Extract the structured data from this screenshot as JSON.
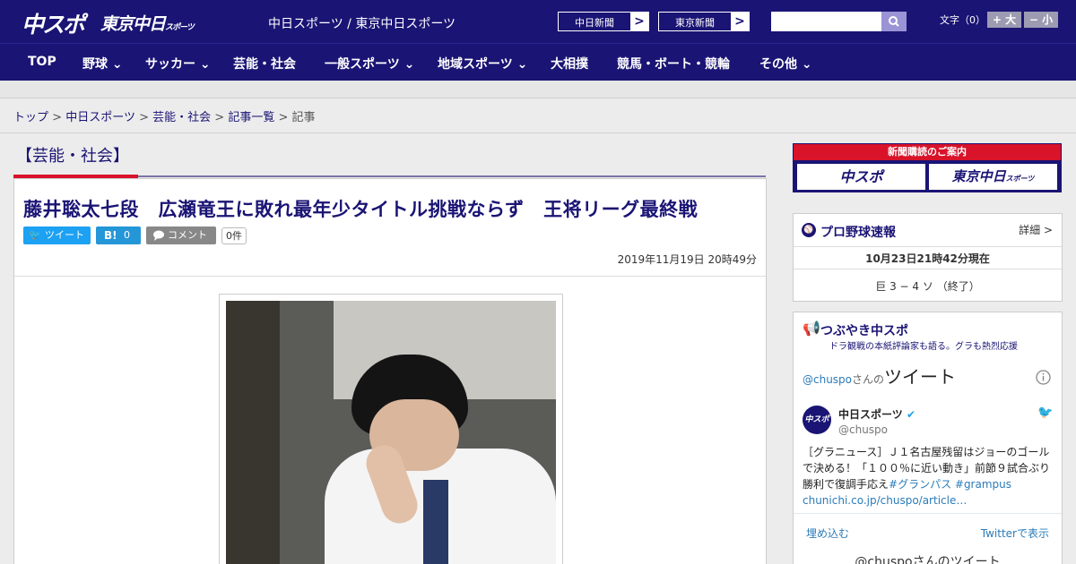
{
  "header": {
    "logo_main": "中スポ",
    "logo_tokyo": "東京中日",
    "logo_tokyo_small": "スポーツ",
    "site_name": "中日スポーツ / 東京中日スポーツ",
    "paper_button_1": "中日新聞",
    "paper_button_2": "東京新聞",
    "arrow": ">",
    "search_placeholder": "",
    "font_size_label": "文字（0）",
    "font_plus": "+ 大",
    "font_minus": "− 小"
  },
  "nav": {
    "items": [
      "TOP",
      "野球",
      "サッカー",
      "芸能・社会",
      "一般スポーツ",
      "地域スポーツ",
      "大相撲",
      "競馬・ボート・競輪",
      "その他"
    ],
    "chevron": "⌄"
  },
  "breadcrumb": {
    "items": [
      "トップ",
      "中日スポーツ",
      "芸能・社会",
      "記事一覧"
    ],
    "current": "記事",
    "sep": ">"
  },
  "article": {
    "section": "【芸能・社会】",
    "headline": "藤井聡太七段　広瀬竜王に敗れ最年少タイトル挑戦ならず　王将リーグ最終戦",
    "tweet_label": "ツイート",
    "hatena_label": "B!",
    "hatena_count": "0",
    "comment_label": "コメント",
    "comment_count": "0件",
    "date": "2019年11月19日 20時49分"
  },
  "sidebar": {
    "ad_top": "新聞購読のご案内",
    "ad_left": "中スポ",
    "ad_right": "東京中日",
    "ad_right_small": "スポーツ",
    "baseball": {
      "title": "プロ野球速報",
      "detail": "詳細 >",
      "as_of": "10月23日21時42分現在",
      "score": "巨 3 − 4 ソ （終了）"
    },
    "tweets": {
      "title": "つぶやき中スポ",
      "subtitle": "ドラ観戦の本紙評論家も語る。グラも熱烈応援",
      "handle_prefix": "@chuspo",
      "handle_suffix": "さんの",
      "tweet_word": "ツイート",
      "account_name": "中日スポーツ",
      "account_handle": "@chuspo",
      "avatar_text": "中スポ",
      "tweet_text": "［グラニュース］Ｊ１名古屋残留はジョーのゴールで決める！「１００％に近い動き」前節９試合ぶり勝利で復調手応え",
      "hashtags": "#グランパス #grampus",
      "link": "chunichi.co.jp/chuspo/article…",
      "embed": "埋め込む",
      "view_on_twitter": "Twitterで表示",
      "footer": "@chuspoさんのツイート"
    }
  }
}
